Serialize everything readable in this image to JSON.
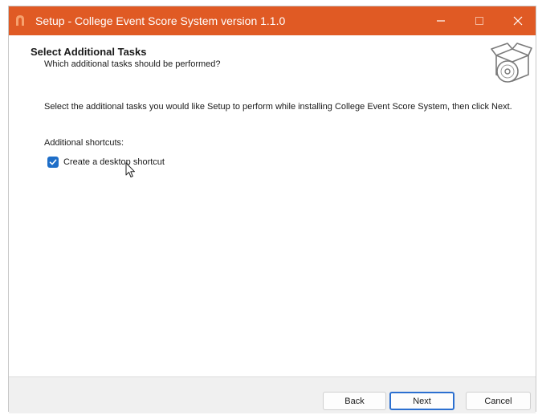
{
  "window": {
    "title": "Setup - College Event Score System version 1.1.0"
  },
  "header": {
    "title": "Select Additional Tasks",
    "subtitle": "Which additional tasks should be performed?",
    "icon": "setup-box-icon"
  },
  "content": {
    "description": "Select the additional tasks you would like Setup to perform while installing College Event Score System, then click Next.",
    "section_label": "Additional shortcuts:",
    "tasks": [
      {
        "label": "Create a desktop shortcut",
        "checked": true
      }
    ]
  },
  "buttons": {
    "back": "Back",
    "next": "Next",
    "cancel": "Cancel"
  },
  "colors": {
    "titlebar": "#e05a24",
    "accent": "#1e6ec8"
  }
}
